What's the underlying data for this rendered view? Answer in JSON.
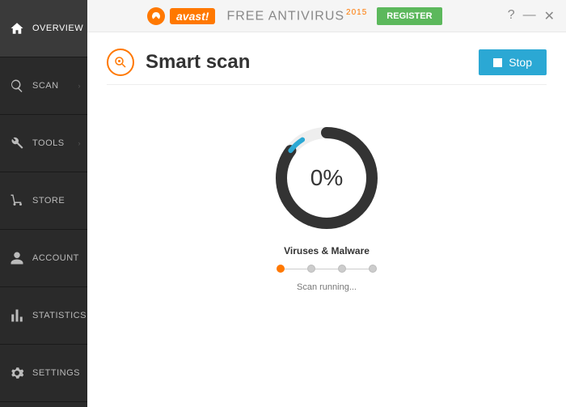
{
  "header": {
    "brand": "avast!",
    "product": "FREE ANTIVIRUS",
    "year": "2015",
    "register_label": "REGISTER",
    "help_glyph": "?",
    "minimize_glyph": "—",
    "close_glyph": "✕"
  },
  "sidebar": {
    "items": [
      {
        "label": "OVERVIEW"
      },
      {
        "label": "SCAN"
      },
      {
        "label": "TOOLS"
      },
      {
        "label": "STORE"
      },
      {
        "label": "ACCOUNT"
      },
      {
        "label": "STATISTICS"
      },
      {
        "label": "SETTINGS"
      }
    ]
  },
  "scan": {
    "title": "Smart scan",
    "stop_label": "Stop",
    "progress_pct": "0%",
    "current_step": "Viruses & Malware",
    "status": "Scan running...",
    "step_count": 4,
    "active_step_index": 0
  }
}
